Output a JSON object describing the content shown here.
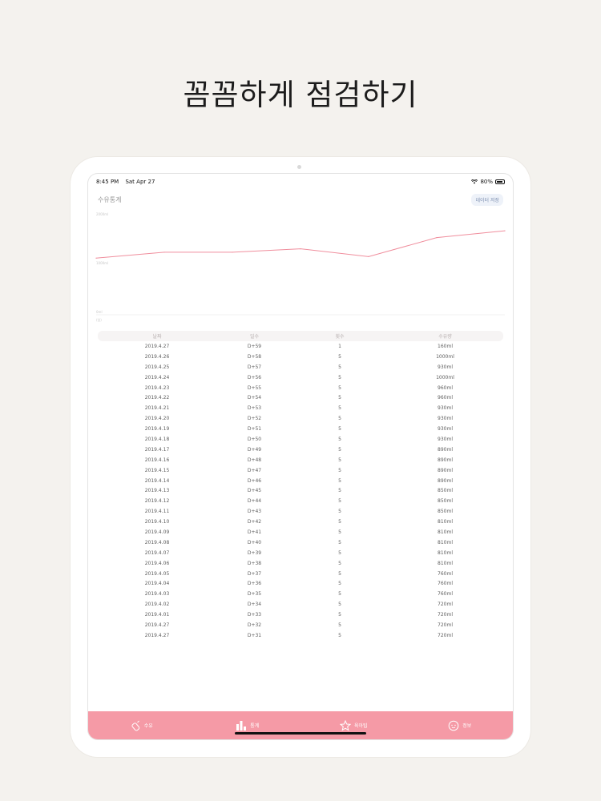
{
  "headline": "꼼꼼하게 점검하기",
  "status_bar": {
    "time": "8:45 PM",
    "date": "Sat Apr 27",
    "battery": "80%"
  },
  "page": {
    "title": "수유통계",
    "save_button": "데이터 저장"
  },
  "chart_data": {
    "type": "line",
    "y_tick_labels": [
      "2000ml",
      "1000ml",
      "0ml"
    ],
    "x_label": "(일)",
    "values": [
      1160,
      1280,
      1280,
      1350,
      1190,
      1580,
      1720
    ],
    "ylim": [
      0,
      2000
    ],
    "grid": false,
    "color": "#f08e9d"
  },
  "table": {
    "headers": [
      "날짜",
      "일수",
      "횟수",
      "수유량"
    ],
    "rows": [
      [
        "2019.4.27",
        "D+59",
        "1",
        "160ml"
      ],
      [
        "2019.4.26",
        "D+58",
        "5",
        "1000ml"
      ],
      [
        "2019.4.25",
        "D+57",
        "5",
        "930ml"
      ],
      [
        "2019.4.24",
        "D+56",
        "5",
        "1000ml"
      ],
      [
        "2019.4.23",
        "D+55",
        "5",
        "960ml"
      ],
      [
        "2019.4.22",
        "D+54",
        "5",
        "960ml"
      ],
      [
        "2019.4.21",
        "D+53",
        "5",
        "930ml"
      ],
      [
        "2019.4.20",
        "D+52",
        "5",
        "930ml"
      ],
      [
        "2019.4.19",
        "D+51",
        "5",
        "930ml"
      ],
      [
        "2019.4.18",
        "D+50",
        "5",
        "930ml"
      ],
      [
        "2019.4.17",
        "D+49",
        "5",
        "890ml"
      ],
      [
        "2019.4.16",
        "D+48",
        "5",
        "890ml"
      ],
      [
        "2019.4.15",
        "D+47",
        "5",
        "890ml"
      ],
      [
        "2019.4.14",
        "D+46",
        "5",
        "890ml"
      ],
      [
        "2019.4.13",
        "D+45",
        "5",
        "850ml"
      ],
      [
        "2019.4.12",
        "D+44",
        "5",
        "850ml"
      ],
      [
        "2019.4.11",
        "D+43",
        "5",
        "850ml"
      ],
      [
        "2019.4.10",
        "D+42",
        "5",
        "810ml"
      ],
      [
        "2019.4.09",
        "D+41",
        "5",
        "810ml"
      ],
      [
        "2019.4.08",
        "D+40",
        "5",
        "810ml"
      ],
      [
        "2019.4.07",
        "D+39",
        "5",
        "810ml"
      ],
      [
        "2019.4.06",
        "D+38",
        "5",
        "810ml"
      ],
      [
        "2019.4.05",
        "D+37",
        "5",
        "760ml"
      ],
      [
        "2019.4.04",
        "D+36",
        "5",
        "760ml"
      ],
      [
        "2019.4.03",
        "D+35",
        "5",
        "760ml"
      ],
      [
        "2019.4.02",
        "D+34",
        "5",
        "720ml"
      ],
      [
        "2019.4.01",
        "D+33",
        "5",
        "720ml"
      ],
      [
        "2019.4.27",
        "D+32",
        "5",
        "720ml"
      ],
      [
        "2019.4.27",
        "D+31",
        "5",
        "720ml"
      ]
    ]
  },
  "tabs": [
    {
      "label": "수유",
      "icon": "bottle-icon"
    },
    {
      "label": "통계",
      "icon": "bar-chart-icon"
    },
    {
      "label": "육아팁",
      "icon": "star-icon"
    },
    {
      "label": "정보",
      "icon": "baby-face-icon"
    }
  ]
}
